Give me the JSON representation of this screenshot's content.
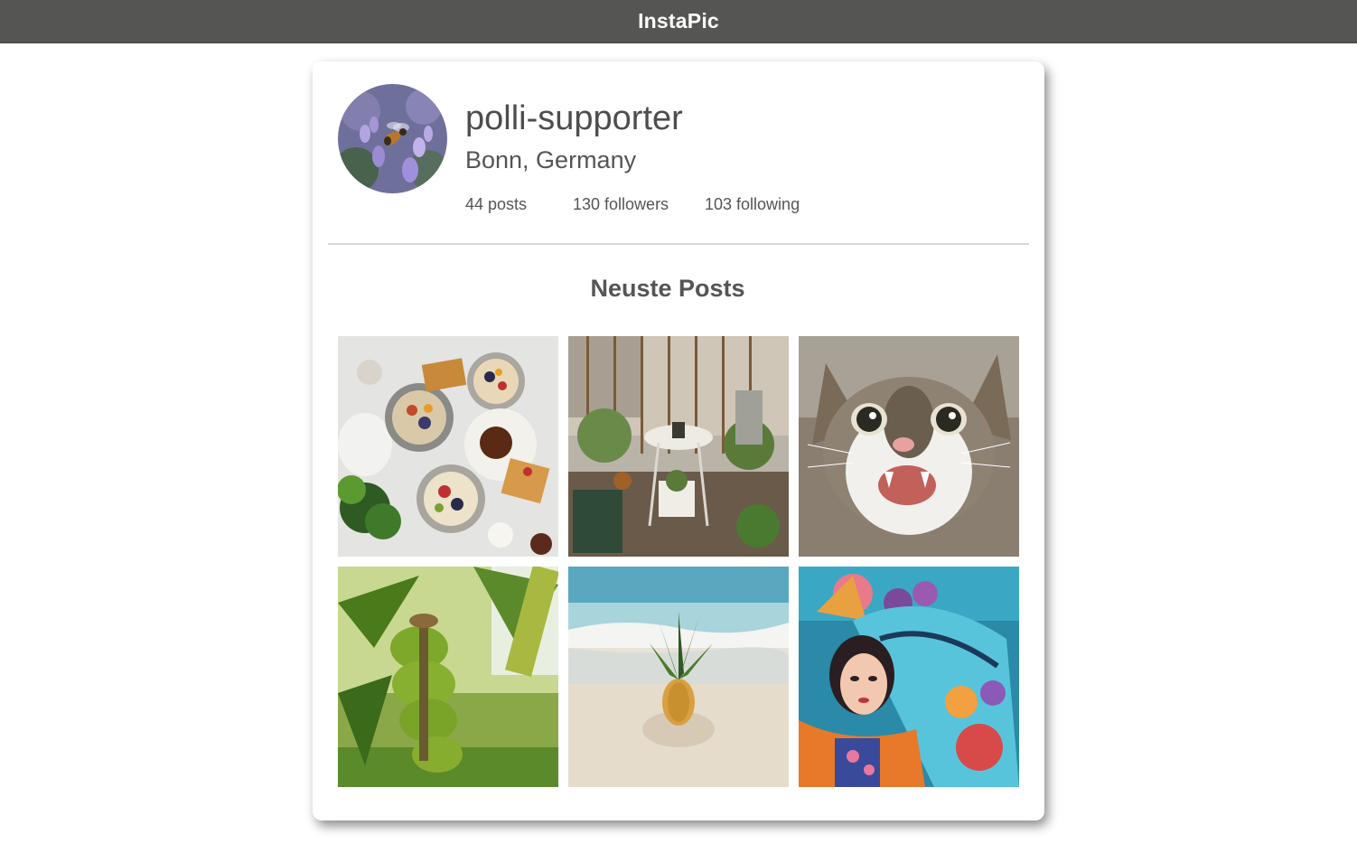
{
  "app": {
    "title": "InstaPic"
  },
  "profile": {
    "username": "polli-supporter",
    "location": "Bonn, Germany",
    "stats": {
      "posts": "44 posts",
      "followers": "130 followers",
      "following": "103 following"
    }
  },
  "posts_section": {
    "title": "Neuste Posts",
    "posts": [
      {
        "subject": "breakfast-bowls"
      },
      {
        "subject": "balcony-garden"
      },
      {
        "subject": "cat"
      },
      {
        "subject": "bananas"
      },
      {
        "subject": "pineapple-beach"
      },
      {
        "subject": "painted-woman-art"
      }
    ]
  },
  "colors": {
    "topbar": "#555553",
    "text": "#555555",
    "card_bg": "#ffffff"
  }
}
